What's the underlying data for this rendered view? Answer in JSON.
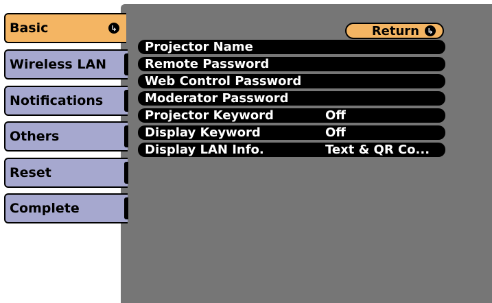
{
  "tabs": [
    {
      "label": "Basic",
      "active": true
    },
    {
      "label": "Wireless LAN"
    },
    {
      "label": "Notifications"
    },
    {
      "label": "Others"
    },
    {
      "label": "Reset"
    },
    {
      "label": "Complete"
    }
  ],
  "return_button": {
    "label": "Return"
  },
  "menu": [
    {
      "label": "Projector Name",
      "value": ""
    },
    {
      "label": "Remote Password",
      "value": ""
    },
    {
      "label": "Web Control Password",
      "value": ""
    },
    {
      "label": "Moderator Password",
      "value": ""
    },
    {
      "label": "Projector Keyword",
      "value": "Off"
    },
    {
      "label": "Display Keyword",
      "value": "Off"
    },
    {
      "label": "Display LAN Info.",
      "value": "Text & QR Co..."
    }
  ],
  "icons": {
    "enter": "enter-icon"
  },
  "colors": {
    "tab_active": "#f4b563",
    "tab_inactive": "#a6a8cf",
    "panel": "#767676"
  }
}
